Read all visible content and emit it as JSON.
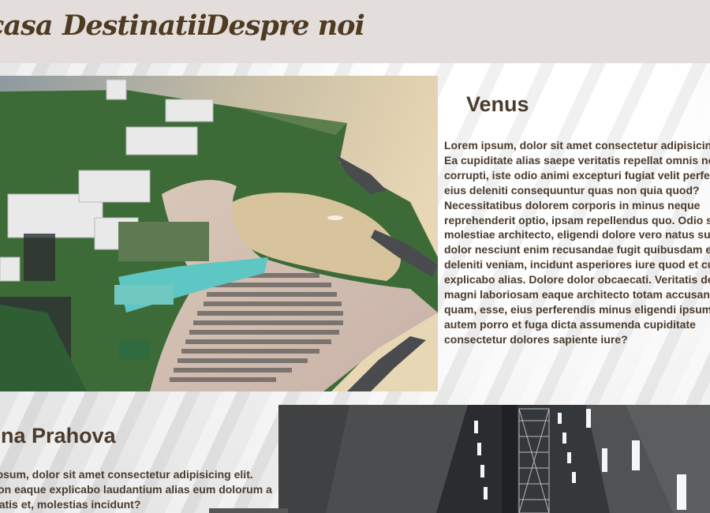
{
  "nav": {
    "home": "Acasa",
    "destinations": "Destinatii",
    "about": "Despre noi"
  },
  "sections": {
    "venus": {
      "title": "Venus",
      "text": "Lorem ipsum, dolor sit amet consectetur adipisicing elit. Ea cupiditate alias saepe veritatis repellat omnis nobis corrupti, iste odio animi excepturi fugiat velit perferendis eius deleniti consequuntur quas non quia quod? Necessitatibus dolorem corporis in minus neque reprehenderit optio, ipsam repellendus quo. Odio sunt molestiae architecto, eligendi dolore vero natus suscipit dolor nesciunt enim recusandae fugit quibusdam error a deleniti veniam, incidunt asperiores iure quod et culpa explicabo alias. Dolore dolor obcaecati. Veritatis debitis magni laboriosam eaque architecto totam accusantium quam, esse, eius perferendis minus eligendi ipsum autem porro et fuga dicta assumenda cupiditate consectetur dolores sapiente iure?"
    },
    "salina": {
      "title": "Salina Prahova",
      "text": "Lorem ipsum, dolor sit amet consectetur adipisicing elit. Quam non eaque explicabo laudantium alias eum dolorum a perspiciatis et, molestias incidunt?"
    }
  }
}
